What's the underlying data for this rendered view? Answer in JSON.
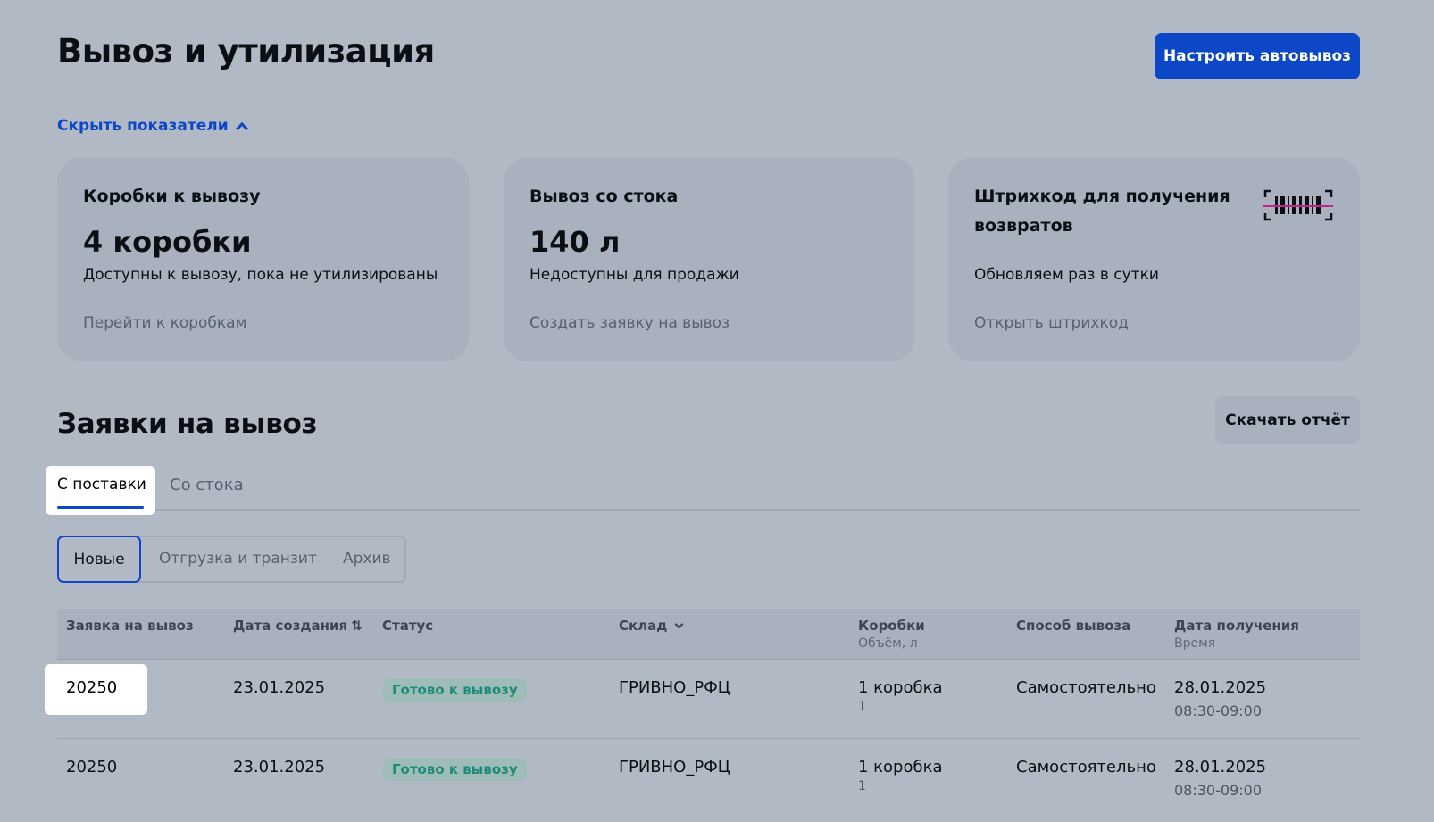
{
  "header": {
    "title": "Вывоз и утилизация",
    "autoexport_button": "Настроить автовывоз",
    "toggle_metrics": "Скрыть показатели"
  },
  "cards": [
    {
      "title": "Коробки к вывозу",
      "value": "4 коробки",
      "description": "Доступны к вывозу, пока не утилизированы",
      "link": "Перейти к коробкам"
    },
    {
      "title": "Вывоз со стока",
      "value": "140 л",
      "description": "Недоступны для продажи",
      "link": "Создать заявку на вывоз"
    },
    {
      "title": "Штрихкод для получения возвратов",
      "icon": "barcode-icon",
      "description": "Обновляем раз в сутки",
      "link": "Открыть штрихкод"
    }
  ],
  "requests": {
    "title": "Заявки на вывоз",
    "download_button": "Скачать отчёт",
    "tabs": [
      "С поставки",
      "Со стока"
    ],
    "active_tab": 0,
    "segments": [
      "Новые",
      "Отгрузка и транзит",
      "Архив"
    ],
    "active_segment": 0
  },
  "table": {
    "columns": [
      {
        "label": "Заявка на вывоз",
        "sub": ""
      },
      {
        "label": "Дата создания",
        "sub": "",
        "icon": "sort-icon"
      },
      {
        "label": "Статус",
        "sub": ""
      },
      {
        "label": "Склад",
        "sub": "",
        "icon": "chevron-down-icon"
      },
      {
        "label": "Коробки",
        "sub": "Объём, л"
      },
      {
        "label": "Способ вывоза",
        "sub": ""
      },
      {
        "label": "Дата получения",
        "sub": "Время"
      }
    ],
    "rows": [
      {
        "id": "20250",
        "created": "23.01.2025",
        "status": "Готово к вывозу",
        "warehouse": "ГРИВНО_РФЦ",
        "boxes": "1 коробка",
        "volume": "1",
        "method": "Самостоятельно",
        "pickup_date": "28.01.2025",
        "pickup_time": "08:30-09:00"
      },
      {
        "id": "20250",
        "created": "23.01.2025",
        "status": "Готово к вывозу",
        "warehouse": "ГРИВНО_РФЦ",
        "boxes": "1 коробка",
        "volume": "1",
        "method": "Самостоятельно",
        "pickup_date": "28.01.2025",
        "pickup_time": "08:30-09:00"
      }
    ]
  },
  "colors": {
    "background": "#b1bac4",
    "accent": "#0c47c8",
    "status_ready": "#1f8a78"
  }
}
